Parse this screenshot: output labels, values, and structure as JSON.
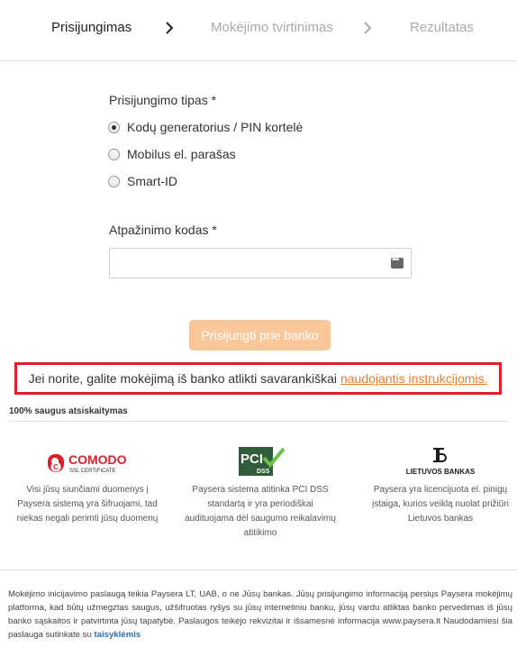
{
  "steps": {
    "step1": "Prisijungimas",
    "step2": "Mokėjimo tvirtinimas",
    "step3": "Rezultatas"
  },
  "login_type": {
    "label": "Prisijungimo tipas *",
    "options": [
      {
        "label": "Kodų generatorius / PIN kortelė",
        "checked": true
      },
      {
        "label": "Mobilus el. parašas",
        "checked": false
      },
      {
        "label": "Smart-ID",
        "checked": false
      }
    ]
  },
  "id_code": {
    "label": "Atpažinimo kodas *",
    "value": "",
    "placeholder": ""
  },
  "login_button": "Prisijungti prie banko",
  "notice": {
    "text": "Jei norite, galite mokėjimą iš banko atlikti savarankiškai",
    "link": "naudojantis instrukcijomis."
  },
  "secure": {
    "title": "100% saugus atsiskaitymas",
    "badges": [
      {
        "logo_main": "COMODO",
        "logo_sub": "SSL CERTIFICATE",
        "text": "Visi jūsų siunčiami duomenys į Paysera sistemą yra šifruojami, tad niekas negali perimti jūsų duomenų"
      },
      {
        "logo_main": "PCI",
        "logo_sub": "DSS",
        "text": "Paysera sistema atitinka PCI DSS standartą ir yra periodiškai audituojama dėl saugumo reikalavimų atitikimo"
      },
      {
        "logo_main": "LIETUVOS BANKAS",
        "logo_sub": "",
        "text": "Paysera yra licencijuota el. pinigų įstaiga, kurios veiklą nuolat prižiūri Lietuvos bankas"
      }
    ]
  },
  "footer": {
    "text": "Mokėjimo inicijavimo paslaugą teikia Paysera LT, UAB, o ne Jūsų bankas. Jūsų prisijungimo informaciją persiųs Paysera mokėjimų platforma, kad būtų užmegztas saugus, užšifruotas ryšys su jūsų internetiniu banku, jūsų vardu atliktas banko pervedimas iš jūsų banko sąskaitos ir patvirtinta jūsų tapatybė. Paslaugos teikėjo rekvizitai ir išsamesnė informacija www.paysera.lt Naudodamiesi šia paslauga sutinkate su",
    "link": "taisyklėmis"
  },
  "colors": {
    "accent_orange": "#ef7a2a",
    "button_disabled": "#f9c79a",
    "notice_border": "#e0202a",
    "comodo_red": "#d9202b",
    "pci_green": "#2f5c3a",
    "link_blue": "#2a6db0"
  }
}
